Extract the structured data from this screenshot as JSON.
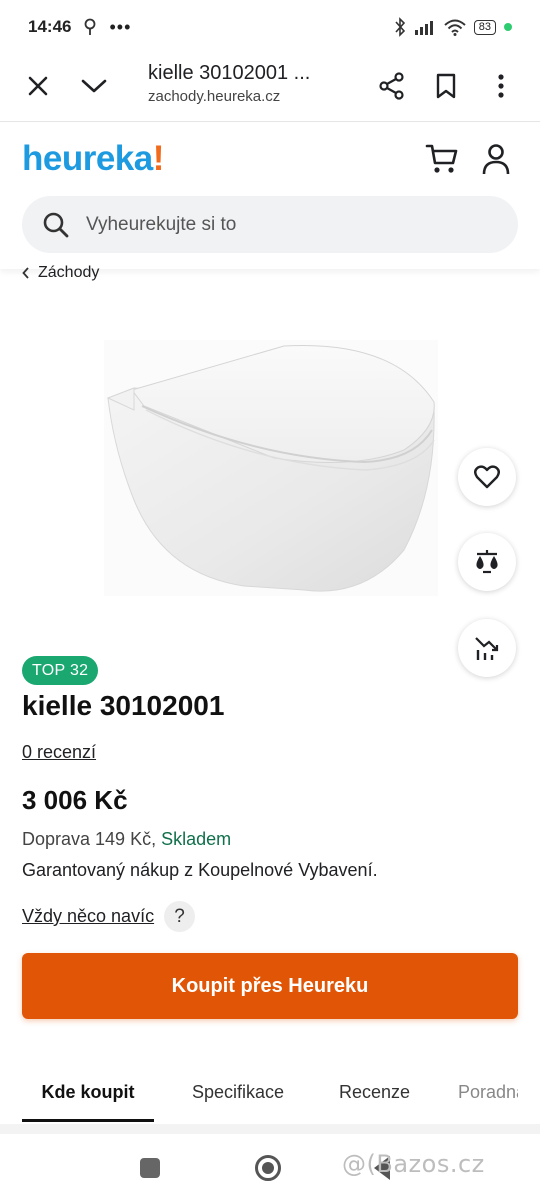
{
  "status_bar": {
    "time": "14:46",
    "battery": "83"
  },
  "browser": {
    "title": "kielle 30102001 ...",
    "url": "zachody.heureka.cz",
    "icons": [
      "close-icon",
      "chevron-down-icon",
      "share-icon",
      "bookmark-icon",
      "more-vert-icon"
    ]
  },
  "header": {
    "logo_text": "heureka",
    "logo_mark": "!",
    "logo_color": "#1e9be0",
    "logo_accent": "#f26b1d",
    "search_placeholder": "Vyheurekujte si to"
  },
  "breadcrumb": {
    "label": "Záchody"
  },
  "product": {
    "badge": "TOP 32",
    "badge_color": "#1aa870",
    "title": "kielle 30102001",
    "reviews": "0 recenzí",
    "price": "3 006 Kč",
    "shipping": "Doprava 149 Kč,",
    "stock": "Skladem",
    "guarantee": "Garantovaný nákup z Koupelnové Vybavení.",
    "extra_link": "Vždy něco navíc",
    "help": "?"
  },
  "buy_button": {
    "label": "Koupit přes Heureku",
    "color": "#e05606"
  },
  "tabs": [
    {
      "label": "Kde koupit",
      "active": true
    },
    {
      "label": "Specifikace",
      "active": false
    },
    {
      "label": "Recenze",
      "active": false
    },
    {
      "label": "Poradna",
      "active": false
    }
  ],
  "watermark": "@(Bazos.cz"
}
